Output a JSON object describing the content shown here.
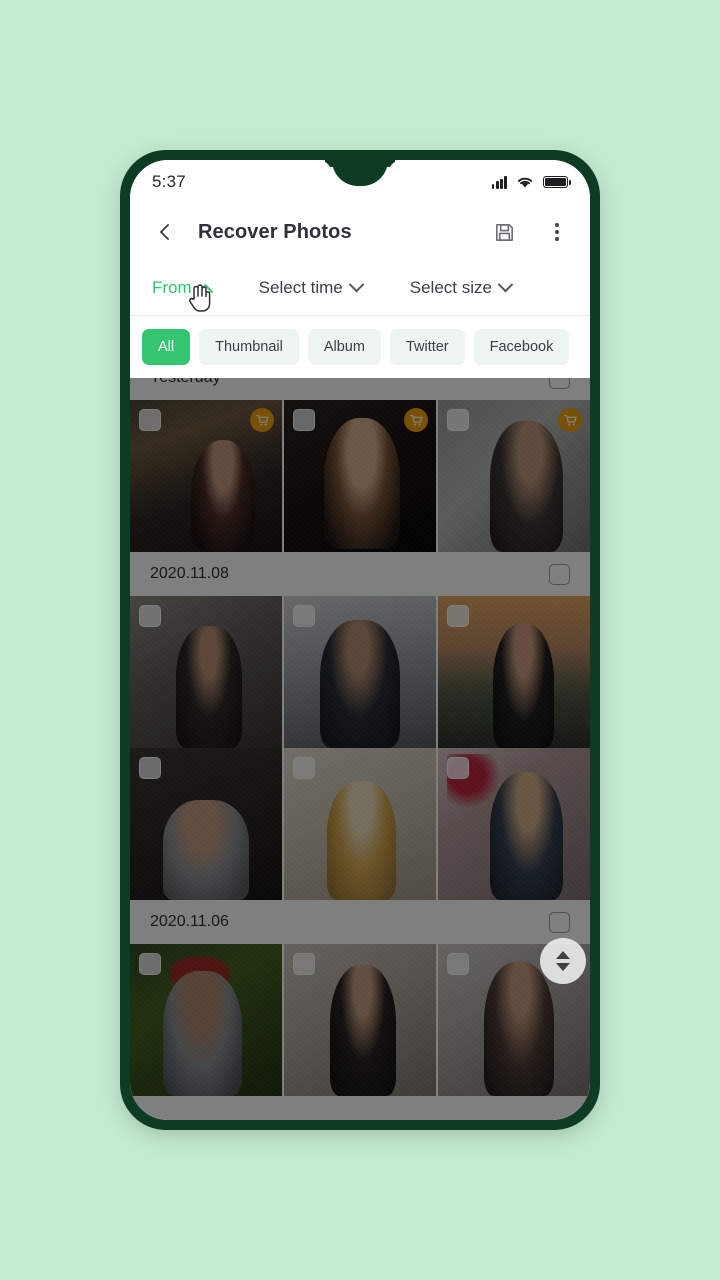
{
  "theme": {
    "page_background": "#c4ecd1",
    "phone_frame": "#0d3b24",
    "accent_green": "#35c46f",
    "filter_active_green": "#2fc770",
    "badge_orange": "#f0a00c",
    "overlay": "rgba(0,0,0,0.50)"
  },
  "status_bar": {
    "time": "5:37",
    "signal_icon": "signal-bars-icon",
    "wifi_icon": "wifi-icon",
    "battery_icon": "battery-full-icon"
  },
  "app_bar": {
    "back_icon": "back-chevron-icon",
    "title": "Recover Photos",
    "save_icon": "save-floppy-icon",
    "menu_icon": "overflow-menu-icon"
  },
  "filters": [
    {
      "label": "From",
      "state": "expanded",
      "chevron": "chevron-up-icon",
      "active": true
    },
    {
      "label": "Select time",
      "state": "collapsed",
      "chevron": "chevron-down-icon",
      "active": false
    },
    {
      "label": "Select size",
      "state": "collapsed",
      "chevron": "chevron-down-icon",
      "active": false
    }
  ],
  "cursor": {
    "icon": "hand-pointer-cursor"
  },
  "chips": [
    {
      "label": "All",
      "active": true
    },
    {
      "label": "Thumbnail",
      "active": false
    },
    {
      "label": "Album",
      "active": false
    },
    {
      "label": "Twitter",
      "active": false
    },
    {
      "label": "Facebook",
      "active": false
    }
  ],
  "sections": [
    {
      "date": "Yesterday",
      "selected": false,
      "rows": [
        [
          {
            "art": "p1",
            "checked": false,
            "badge": "cart-badge-icon"
          },
          {
            "art": "p2",
            "checked": false,
            "badge": "cart-badge-icon"
          },
          {
            "art": "p3",
            "checked": false,
            "badge": "cart-badge-icon"
          }
        ]
      ]
    },
    {
      "date": "2020.11.08",
      "selected": false,
      "rows": [
        [
          {
            "art": "p4",
            "checked": false,
            "badge": null
          },
          {
            "art": "p5",
            "checked": false,
            "badge": null
          },
          {
            "art": "p6",
            "checked": false,
            "badge": null
          }
        ],
        [
          {
            "art": "p7",
            "checked": false,
            "badge": null
          },
          {
            "art": "p8",
            "checked": false,
            "badge": null
          },
          {
            "art": "p9",
            "checked": false,
            "badge": null
          }
        ]
      ]
    },
    {
      "date": "2020.11.06",
      "selected": false,
      "rows": [
        [
          {
            "art": "p10",
            "checked": false,
            "badge": null
          },
          {
            "art": "p11",
            "checked": false,
            "badge": null
          },
          {
            "art": "p12",
            "checked": false,
            "badge": null
          }
        ]
      ]
    }
  ],
  "scrollbar": {
    "up_icon": "triangle-up-icon",
    "down_icon": "triangle-down-icon"
  }
}
